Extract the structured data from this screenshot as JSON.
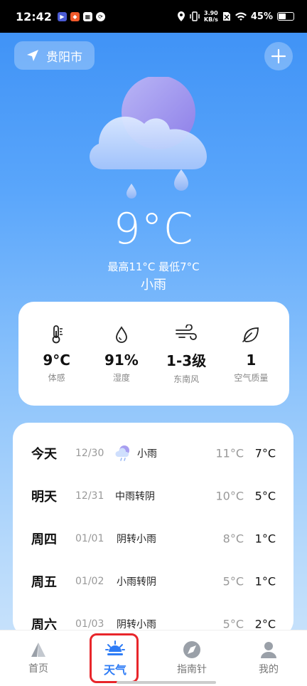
{
  "status_bar": {
    "time": "12:42",
    "net_speed_value": "3.90",
    "net_speed_unit": "KB/s",
    "battery": "45%"
  },
  "location": {
    "city": "贵阳市"
  },
  "current": {
    "temperature": "9°C",
    "hi_lo": "最高11°C 最低7°C",
    "condition": "小雨"
  },
  "stats": [
    {
      "icon": "thermometer-icon",
      "value": "9°C",
      "label": "体感"
    },
    {
      "icon": "humidity-icon",
      "value": "91%",
      "label": "湿度"
    },
    {
      "icon": "wind-icon",
      "value": "1-3级",
      "label": "东南风"
    },
    {
      "icon": "leaf-icon",
      "value": "1",
      "label": "空气质量"
    }
  ],
  "forecast": [
    {
      "day": "今天",
      "date": "12/30",
      "icon": "light-rain-icon",
      "desc": "小雨",
      "high": "11°C",
      "low": "7°C"
    },
    {
      "day": "明天",
      "date": "12/31",
      "icon": "",
      "desc": "中雨转阴",
      "high": "10°C",
      "low": "5°C"
    },
    {
      "day": "周四",
      "date": "01/01",
      "icon": "",
      "desc": "阴转小雨",
      "high": "8°C",
      "low": "1°C"
    },
    {
      "day": "周五",
      "date": "01/02",
      "icon": "",
      "desc": "小雨转阴",
      "high": "5°C",
      "low": "1°C"
    },
    {
      "day": "周六",
      "date": "01/03",
      "icon": "",
      "desc": "阴转小雨",
      "high": "5°C",
      "low": "2°C"
    }
  ],
  "nav": [
    {
      "label": "首页",
      "icon": "home-sail-icon",
      "active": false
    },
    {
      "label": "天气",
      "icon": "weather-sun-icon",
      "active": true
    },
    {
      "label": "指南针",
      "icon": "compass-icon",
      "active": false
    },
    {
      "label": "我的",
      "icon": "profile-icon",
      "active": false
    }
  ],
  "colors": {
    "accent": "#2e7cf6",
    "highlight": "#e8262b"
  }
}
